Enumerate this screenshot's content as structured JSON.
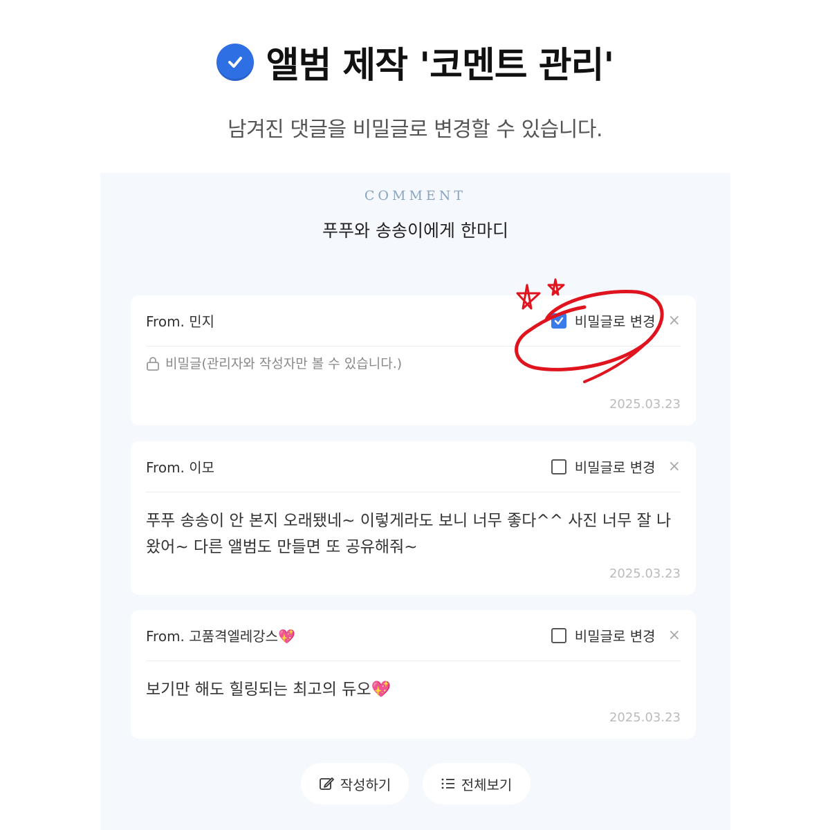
{
  "header": {
    "title": "앨범 제작 '코멘트 관리'",
    "subtitle": "남겨진 댓글을 비밀글로 변경할 수 있습니다."
  },
  "section": {
    "eyebrow": "COMMENT",
    "title": "푸푸와 송송이에게 한마디"
  },
  "comments": [
    {
      "from": "From. 민지",
      "secret_toggle_label": "비밀글로 변경",
      "secret_checked": true,
      "body": "비밀글(관리자와 작성자만 볼 수 있습니다.)",
      "date": "2025.03.23",
      "close": "×"
    },
    {
      "from": "From. 이모",
      "secret_toggle_label": "비밀글로 변경",
      "secret_checked": false,
      "body": "푸푸 송송이 안 본지 오래됐네~ 이렇게라도 보니 너무 좋다^^ 사진 너무 잘 나왔어~ 다른 앨범도 만들면 또 공유해줘~",
      "date": "2025.03.23",
      "close": "×"
    },
    {
      "from": "From. 고품격엘레강스",
      "secret_toggle_label": "비밀글로 변경",
      "secret_checked": false,
      "body": "보기만 해도 힐링되는 최고의 듀오",
      "date": "2025.03.23",
      "close": "×"
    }
  ],
  "buttons": {
    "write": "작성하기",
    "view_all": "전체보기"
  },
  "colors": {
    "accent": "#3a7bec",
    "panel_bg": "#f5f8fd",
    "annotation": "#e0141e",
    "heart": "#e2489b"
  },
  "icons": {
    "heart": "💖"
  }
}
